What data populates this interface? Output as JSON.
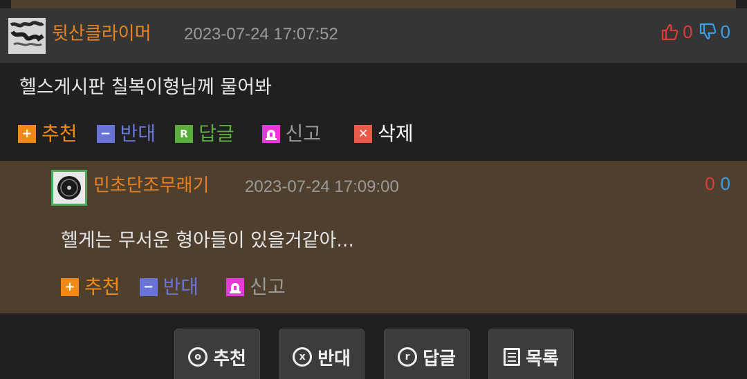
{
  "comments": [
    {
      "nick": "뒷산클라이머",
      "date": "2023-07-24 17:07:52",
      "up": "0",
      "down": "0",
      "text": "헬스게시판 칠복이형님께 물어봐",
      "actions": {
        "recommend": "추천",
        "oppose": "반대",
        "reply": "답글",
        "report": "신고",
        "delete": "삭제"
      }
    },
    {
      "nick": "민초단조무래기",
      "date": "2023-07-24 17:09:00",
      "up": "0",
      "down": "0",
      "text": "헬게는 무서운 형아들이 있을거같아...",
      "actions": {
        "recommend": "추천",
        "oppose": "반대",
        "report": "신고"
      }
    }
  ],
  "bottom": {
    "recommend": "추천",
    "oppose": "반대",
    "reply": "답글",
    "list": "목록"
  },
  "icons": {
    "recommend_icon": "plus-icon",
    "oppose_icon": "minus-icon",
    "reply_icon": "reply-r-icon",
    "report_icon": "siren-icon",
    "delete_icon": "close-icon",
    "thumbs_up": "thumbs-up-icon",
    "thumbs_down": "thumbs-down-icon"
  },
  "colors": {
    "nick": "#e8821e",
    "recommend": "#f08a14",
    "oppose": "#6a74d6",
    "reply": "#5aae3c",
    "report": "#e838d8",
    "delete": "#e85a4a",
    "vote_up": "#e03a3a",
    "vote_down": "#3aa0e8",
    "reply_bg": "#4f3f2e"
  }
}
